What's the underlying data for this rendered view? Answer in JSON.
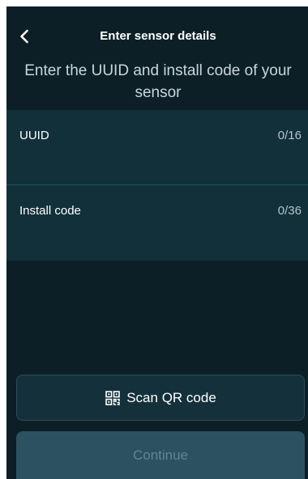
{
  "header": {
    "title": "Enter sensor details",
    "back_icon": "chevron-left-icon"
  },
  "subtitle": "Enter the UUID and install code of your sensor",
  "form": {
    "uuid": {
      "label": "UUID",
      "counter": "0/16",
      "value": ""
    },
    "install_code": {
      "label": "Install code",
      "counter": "0/36",
      "value": ""
    }
  },
  "actions": {
    "scan_label": "Scan QR code",
    "scan_icon": "qr-code-icon",
    "continue_label": "Continue",
    "continue_enabled": false
  },
  "colors": {
    "background": "#0c1f26",
    "panel": "#12303a",
    "divider": "#1f5564",
    "button_secondary": "#14313b",
    "button_disabled": "#2c5262",
    "text_disabled": "#5f8593"
  }
}
